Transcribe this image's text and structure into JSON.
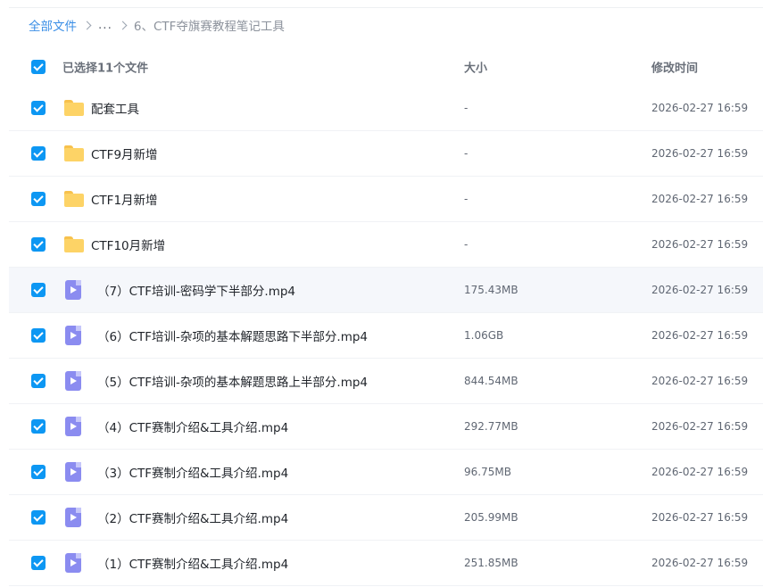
{
  "breadcrumb": {
    "root": "全部文件",
    "ellipsis": "...",
    "current": "6、CTF夺旗赛教程笔记工具"
  },
  "header": {
    "selected": "已选择11个文件",
    "size": "大小",
    "mtime": "修改时间"
  },
  "colors": {
    "checkbox": "#0d97f3",
    "folder": "#fdd366",
    "video_icon": "#8b8cf0",
    "link": "#3a8ee6"
  },
  "files": [
    {
      "type": "folder-icon",
      "name": "配套工具",
      "size": "-",
      "mtime": "2026-02-27 16:59",
      "checked": true
    },
    {
      "type": "folder-icon",
      "name": "CTF9月新增",
      "size": "-",
      "mtime": "2026-02-27 16:59",
      "checked": true
    },
    {
      "type": "folder-icon",
      "name": "CTF1月新增",
      "size": "-",
      "mtime": "2026-02-27 16:59",
      "checked": true
    },
    {
      "type": "folder-icon",
      "name": "CTF10月新增",
      "size": "-",
      "mtime": "2026-02-27 16:59",
      "checked": true
    },
    {
      "type": "video-icon",
      "name": "（7）CTF培训-密码学下半部分.mp4",
      "size": "175.43MB",
      "mtime": "2026-02-27 16:59",
      "checked": true
    },
    {
      "type": "video-icon",
      "name": "（6）CTF培训-杂项的基本解题思路下半部分.mp4",
      "size": "1.06GB",
      "mtime": "2026-02-27 16:59",
      "checked": true
    },
    {
      "type": "video-icon",
      "name": "（5）CTF培训-杂项的基本解题思路上半部分.mp4",
      "size": "844.54MB",
      "mtime": "2026-02-27 16:59",
      "checked": true
    },
    {
      "type": "video-icon",
      "name": "（4）CTF赛制介绍&工具介绍.mp4",
      "size": "292.77MB",
      "mtime": "2026-02-27 16:59",
      "checked": true
    },
    {
      "type": "video-icon",
      "name": "（3）CTF赛制介绍&工具介绍.mp4",
      "size": "96.75MB",
      "mtime": "2026-02-27 16:59",
      "checked": true
    },
    {
      "type": "video-icon",
      "name": "（2）CTF赛制介绍&工具介绍.mp4",
      "size": "205.99MB",
      "mtime": "2026-02-27 16:59",
      "checked": true
    },
    {
      "type": "video-icon",
      "name": "（1）CTF赛制介绍&工具介绍.mp4",
      "size": "251.85MB",
      "mtime": "2026-02-27 16:59",
      "checked": true
    }
  ]
}
